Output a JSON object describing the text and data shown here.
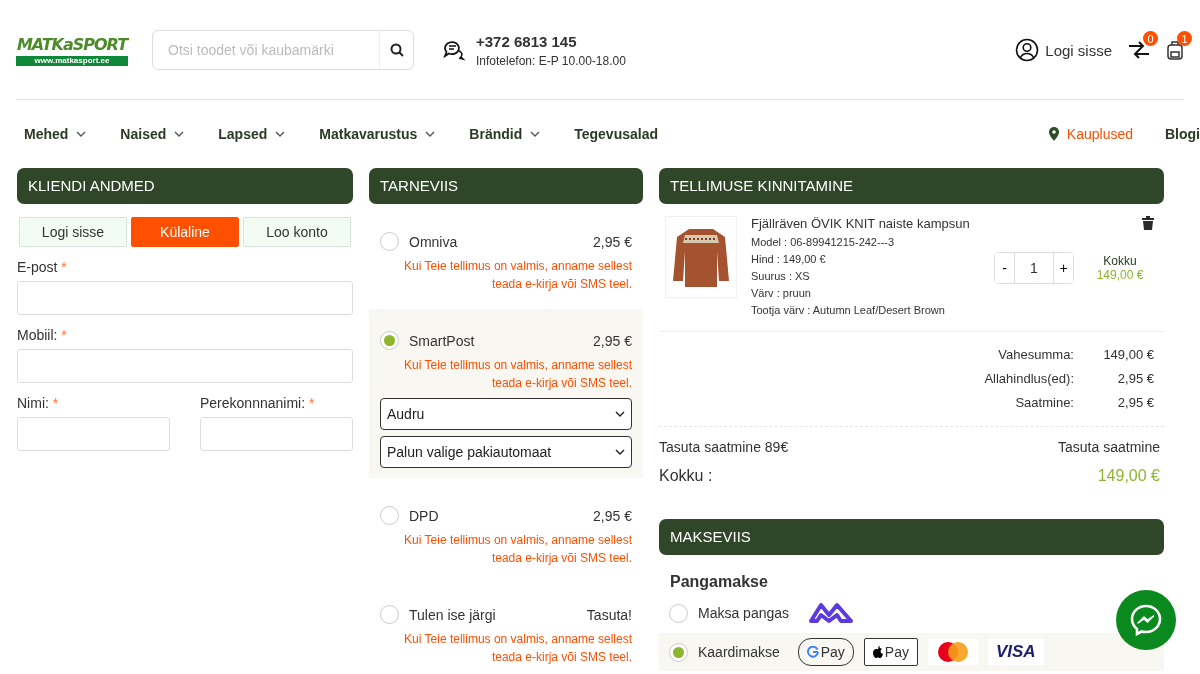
{
  "header": {
    "logo": {
      "wordmark": "MATKaSPORT",
      "url": "www.matkasport.ee"
    },
    "search": {
      "placeholder": "Otsi toodet või kaubamärki"
    },
    "contact": {
      "phone": "+372 6813 145",
      "hours": "Infotelefon: E-P 10.00-18.00"
    },
    "login": "Logi sisse",
    "compare_badge": "0",
    "cart_badge": "1"
  },
  "nav": [
    {
      "label": "Mehed",
      "dropdown": true
    },
    {
      "label": "Naised",
      "dropdown": true
    },
    {
      "label": "Lapsed",
      "dropdown": true
    },
    {
      "label": "Matkavarustus",
      "dropdown": true
    },
    {
      "label": "Brändid",
      "dropdown": true
    },
    {
      "label": "Tegevusalad",
      "dropdown": false
    }
  ],
  "nav_right": {
    "stores": "Kauplused",
    "blog": "Blogi"
  },
  "customer": {
    "title": "KLIENDI ANDMED",
    "tabs": [
      {
        "label": "Logi sisse",
        "selected": false
      },
      {
        "label": "Külaline",
        "selected": true
      },
      {
        "label": "Loo konto",
        "selected": false
      }
    ],
    "field_rows": [
      [
        {
          "label": "E-post",
          "marker": "*"
        }
      ],
      [
        {
          "label": "Mobiil:",
          "marker": "*"
        }
      ],
      [
        {
          "label": "Nimi:",
          "marker": "*"
        },
        {
          "label": "Perekonnnanimi:",
          "marker": "*"
        }
      ]
    ]
  },
  "shipping": {
    "title": "TARNEVIIS",
    "options": [
      {
        "name": "Omniva",
        "price": "2,95 €",
        "note": "Kui Teie tellimus on valmis, anname sellest teada e-kirja või SMS teel.",
        "selected": false
      },
      {
        "name": "SmartPost",
        "price": "2,95 €",
        "note": "Kui Teie tellimus on valmis, anname sellest teada e-kirja või SMS teel.",
        "selected": true,
        "selects": [
          "Audru",
          "Palun valige pakiautomaat"
        ]
      },
      {
        "name": "DPD",
        "price": "2,95 €",
        "note": "Kui Teie tellimus on valmis, anname sellest teada e-kirja või SMS teel.",
        "selected": false
      },
      {
        "name": "Tulen ise järgi",
        "price": "Tasuta!",
        "note": "Kui Teie tellimus on valmis, anname sellest teada e-kirja või SMS teel.",
        "selected": false
      }
    ]
  },
  "order": {
    "title": "TELLIMUSE KINNITAMINE",
    "item": {
      "name": "Fjällräven ÖVIK KNIT naiste kampsun",
      "details": [
        "Model : 06-89941215-242---3",
        "Hind : 149,00 €",
        "Suurus : XS",
        "Värv : pruun",
        "Tootja värv : Autumn Leaf/Desert Brown"
      ],
      "minus": "-",
      "quantity": "1",
      "plus": "+",
      "total_label": "Kokku",
      "total": "149,00 €"
    },
    "summary": [
      {
        "label": "Vahesumma:",
        "value": "149,00 €"
      },
      {
        "label": "Allahindlus(ed):",
        "value": "2,95 €"
      },
      {
        "label": "Saatmine:",
        "value": "2,95 €"
      }
    ],
    "free_shipping": {
      "label": "Tasuta saatmine 89€",
      "value": "Tasuta saatmine"
    },
    "grand_total": {
      "label": "Kokku :",
      "value": "149,00 €"
    }
  },
  "payment": {
    "title": "MAKSEVIIS",
    "group": "Pangamakse",
    "methods": [
      {
        "label": "Maksa pangas",
        "selected": false,
        "logos": [
          {
            "kind": "bank"
          }
        ]
      },
      {
        "label": "Kaardimakse",
        "selected": true,
        "logos": [
          {
            "kind": "gpay",
            "text": "Pay"
          },
          {
            "kind": "applepay",
            "text": "Pay"
          },
          {
            "kind": "mastercard"
          },
          {
            "kind": "visa",
            "text": "VISA"
          }
        ]
      }
    ]
  }
}
